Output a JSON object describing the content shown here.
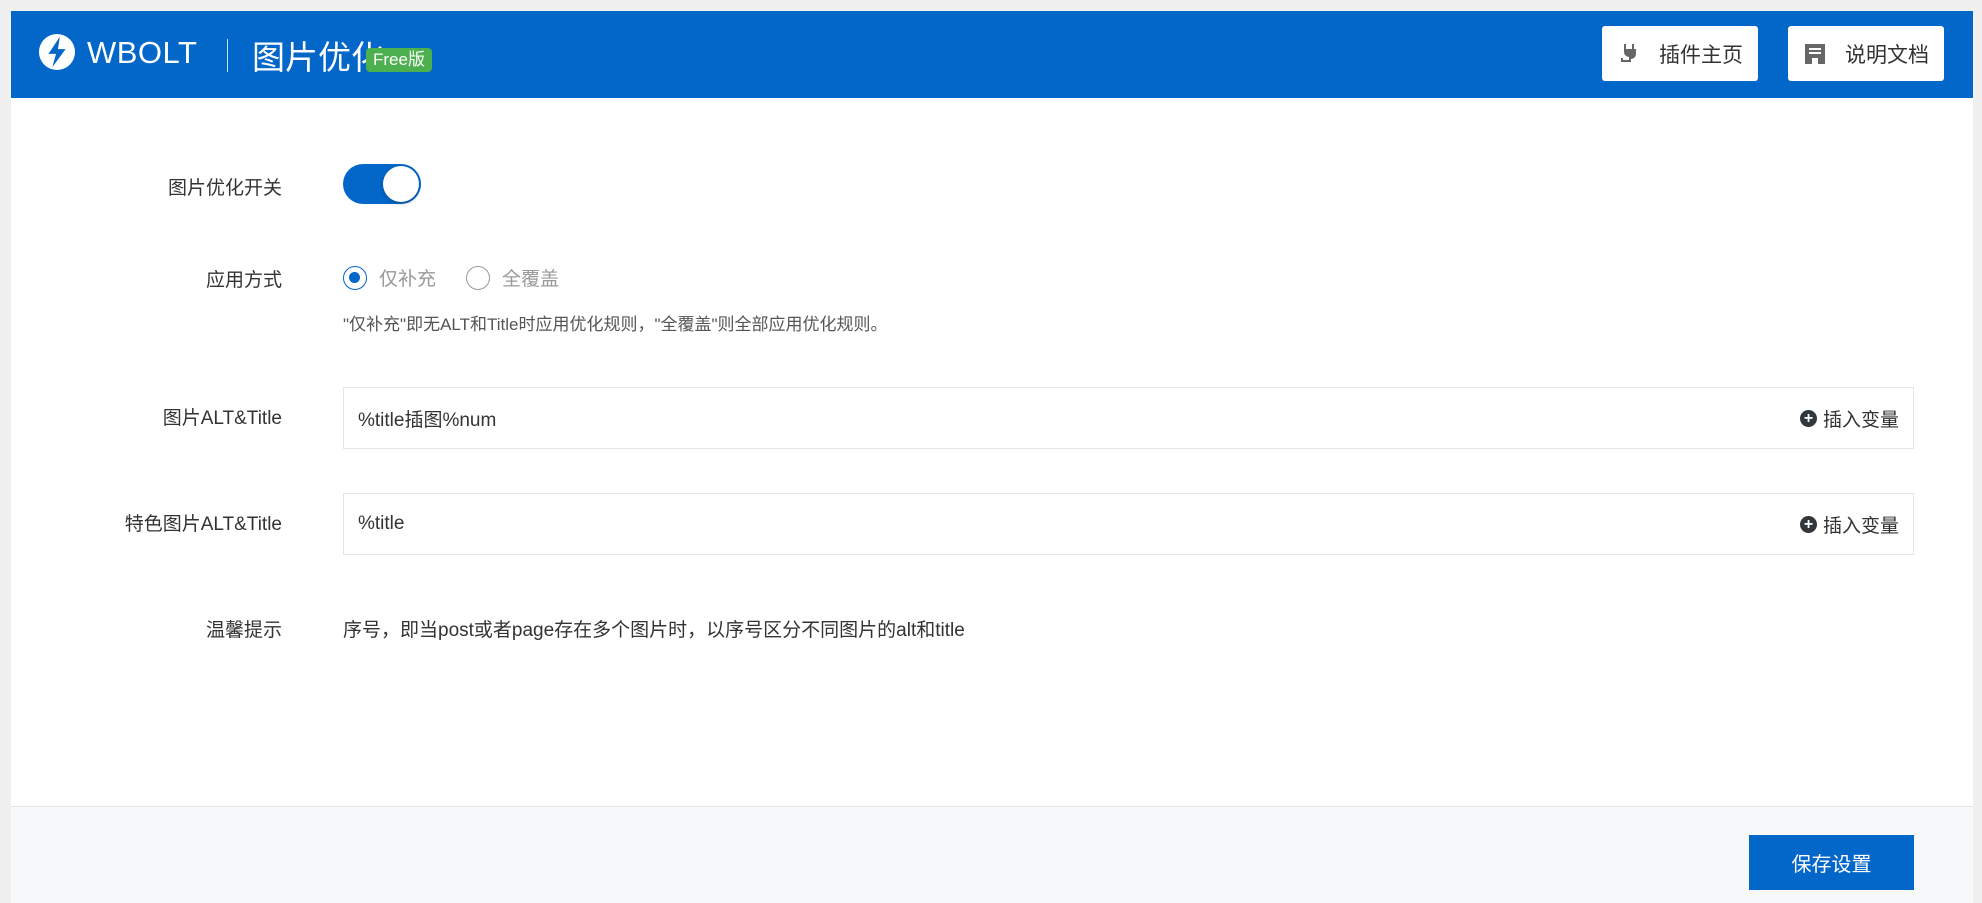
{
  "header": {
    "brand": "WBOLT",
    "title": "图片优化",
    "badge": "Free版",
    "buttons": [
      {
        "label": "插件主页",
        "icon": "plug-icon"
      },
      {
        "label": "说明文档",
        "icon": "document-icon"
      }
    ]
  },
  "colors": {
    "primary": "#0366c9",
    "badge": "#4cb04f"
  },
  "form": {
    "switch": {
      "label": "图片优化开关",
      "on": true
    },
    "mode": {
      "label": "应用方式",
      "options": [
        "仅补充",
        "全覆盖"
      ],
      "selected": "仅补充",
      "hint": "\"仅补充\"即无ALT和Title时应用优化规则，\"全覆盖\"则全部应用优化规则。"
    },
    "alt": {
      "label": "图片ALT&Title",
      "value": "%title插图%num",
      "insert": "插入变量"
    },
    "featured": {
      "label": "特色图片ALT&Title",
      "value": "%title",
      "insert": "插入变量"
    },
    "tip": {
      "label": "温馨提示",
      "text": "序号，即当post或者page存在多个图片时，以序号区分不同图片的alt和title"
    }
  },
  "footer": {
    "save": "保存设置"
  }
}
